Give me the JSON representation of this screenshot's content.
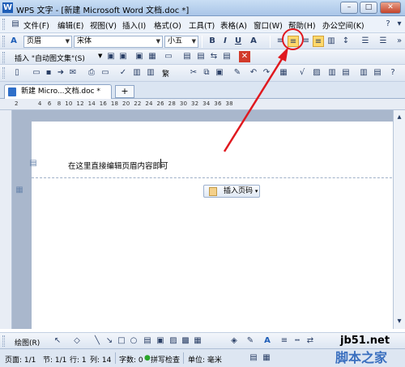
{
  "window": {
    "title": "WPS 文字 - [新建 Microsoft Word 文档.doc *]",
    "minimize": "–",
    "maximize": "□",
    "close": "✕"
  },
  "menu": [
    "文件(F)",
    "编辑(E)",
    "视图(V)",
    "插入(I)",
    "格式(O)",
    "工具(T)",
    "表格(A)",
    "窗口(W)",
    "帮助(H)",
    "办公空间(K)"
  ],
  "formatting": {
    "style_value": "页眉",
    "font_value": "宋体",
    "size_value": "小五",
    "bold": "B",
    "italic": "I",
    "underline": "U",
    "fontsize_grow": "A"
  },
  "secondary_toolbar": {
    "autotext_label": "插入 \"自动图文集\"(S)"
  },
  "standard_toolbar": {
    "trad_label": "繁"
  },
  "tab": {
    "doc_label": "新建 Micro...文档.doc *",
    "new_tab": "+"
  },
  "ruler": {
    "numbers": "2          4   6   8  10  12  14  16  18  20  22  24  26  28  30  32  34  36  38"
  },
  "document": {
    "header_text": "在这里直接编辑页眉内容即可",
    "insert_page_number": "插入页码"
  },
  "drawing_toolbar": {
    "draw_label": "绘图(R)"
  },
  "status": {
    "page": "页面: 1/1",
    "section": "节: 1/1",
    "line": "行: 1",
    "column": "列: 14",
    "word_count": "字数: 0",
    "spell_check": "拼写检查",
    "unit": "单位: 毫米"
  },
  "watermark": {
    "site": "jb51.net",
    "name": "脚本之家"
  },
  "colors": {
    "accent": "#1d5db7",
    "annotation": "#e0191f",
    "active_button": "#ffd96b"
  }
}
